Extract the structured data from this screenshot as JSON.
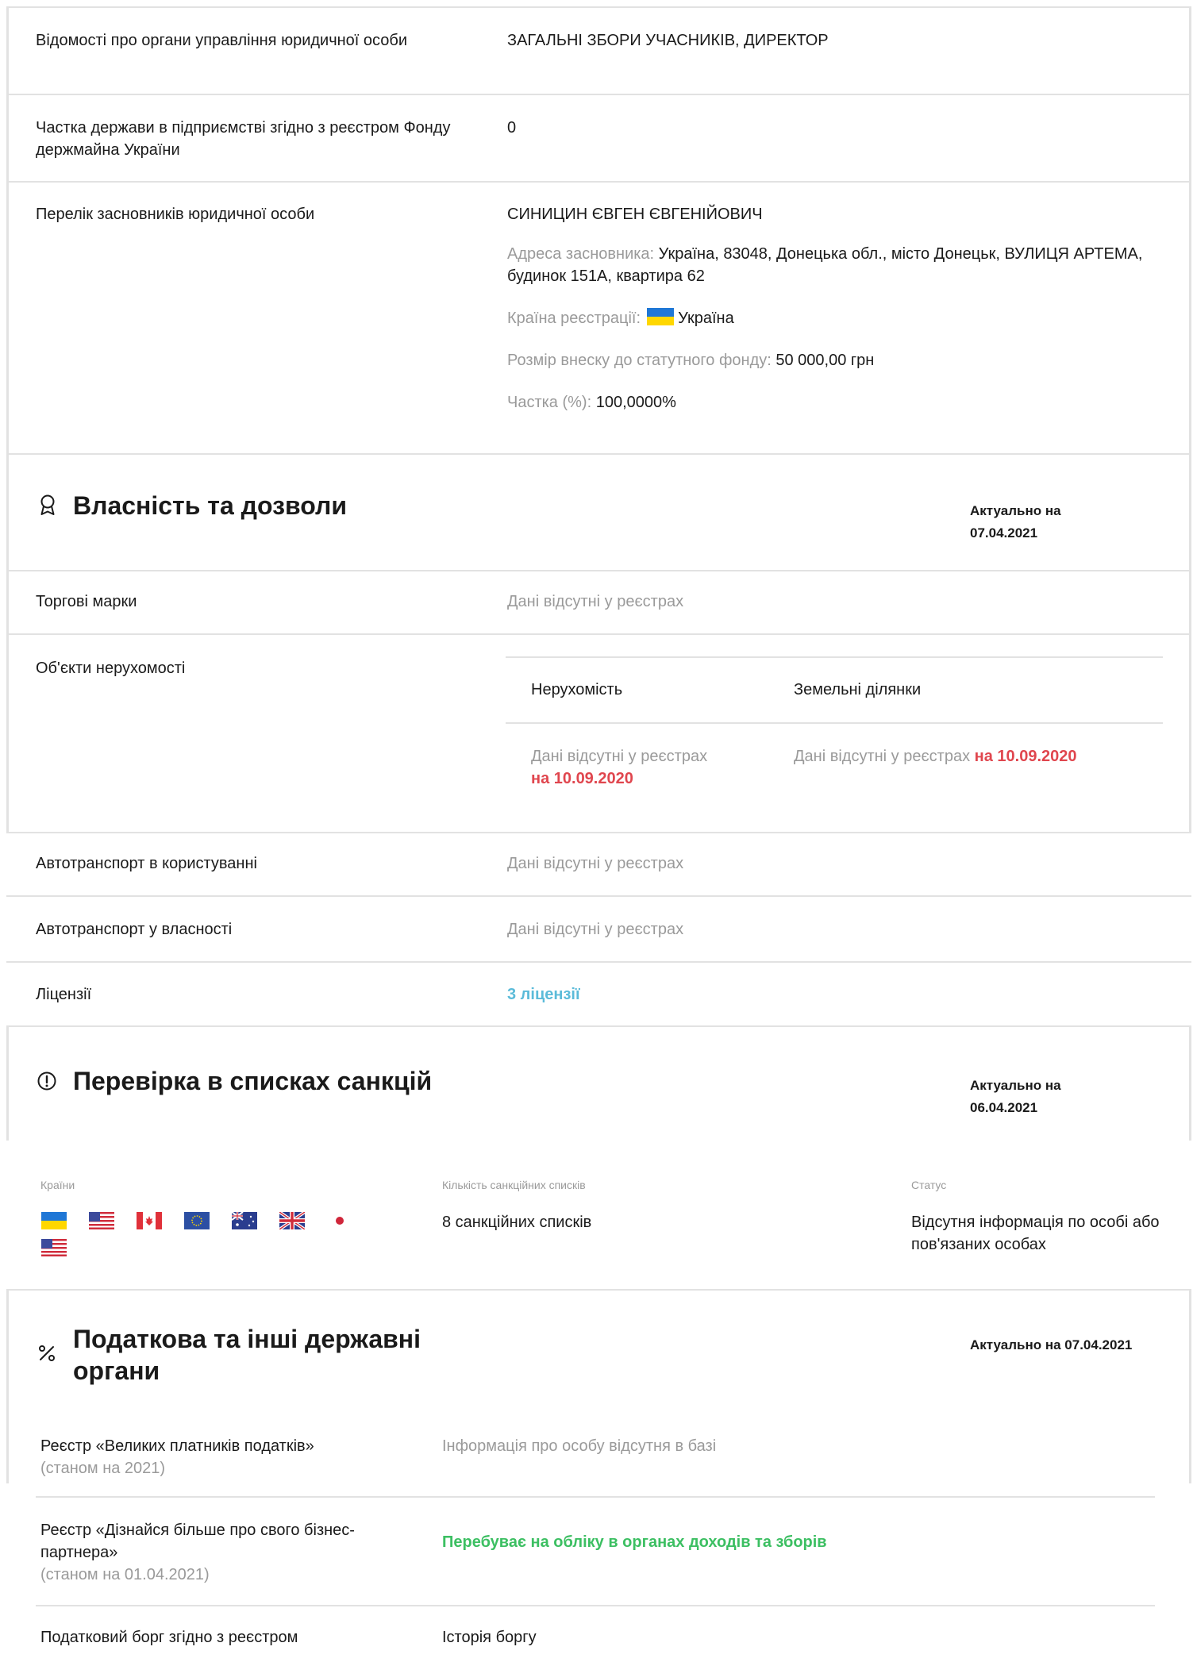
{
  "management": {
    "label": "Відомості про органи управління юридичної особи",
    "value": "ЗАГАЛЬНІ ЗБОРИ УЧАСНИКІВ, ДИРЕКТОР"
  },
  "state_share": {
    "label": "Частка держави в підприємстві згідно з реєстром Фонду держмайна України",
    "value": "0"
  },
  "founders": {
    "label": "Перелік засновників юридичної особи",
    "name": "СИНИЦИН ЄВГЕН ЄВГЕНІЙОВИЧ",
    "address_label": "Адреса засновника:",
    "address_value": "Україна, 83048, Донецька обл., місто Донецьк, ВУЛИЦЯ АРТЕМА, будинок 151А, квартира 62",
    "country_label": "Країна реєстрації:",
    "country_value": "Україна",
    "contribution_label": "Розмір внеску до статутного фонду:",
    "contribution_value": "50 000,00 грн",
    "share_label": "Частка (%):",
    "share_value": "100,0000%"
  },
  "property": {
    "title": "Власність та дозволи",
    "actual_line1": "Актуально на",
    "actual_line2": "07.04.2021",
    "trademarks_label": "Торгові марки",
    "trademarks_value": "Дані відсутні у реєстрах",
    "realty_label": "Об'єкти нерухомості",
    "realty_col1": "Нерухомість",
    "realty_col2": "Земельні ділянки",
    "realty_col1_value": "Дані відсутні у реєстрах",
    "realty_col1_date": "на 10.09.2020",
    "realty_col2_value": "Дані відсутні у реєстрах",
    "realty_col2_date": "на 10.09.2020",
    "vehicles_use_label": "Автотранспорт в користуванні",
    "vehicles_use_value": "Дані відсутні у реєстрах",
    "vehicles_own_label": "Автотранспорт у власності",
    "vehicles_own_value": "Дані відсутні у реєстрах",
    "licenses_label": "Ліцензії",
    "licenses_value": "3 ліцензії"
  },
  "sanctions": {
    "title": "Перевірка в списках санкцій",
    "actual_line1": "Актуально на",
    "actual_line2": "06.04.2021",
    "countries_header": "Країни",
    "count_header": "Кількість санкційних списків",
    "status_header": "Статус",
    "count_value": "8 санкційних списків",
    "status_value": "Відсутня інформація по особі або пов'язаних особах",
    "flags": [
      "ukraine-flag-icon",
      "usa-flag-icon",
      "canada-flag-icon",
      "eu-flag-icon",
      "australia-flag-icon",
      "uk-flag-icon",
      "japan-flag-icon",
      "usa-flag-icon"
    ]
  },
  "tax": {
    "title": "Податкова та інші державні органи",
    "actual": "Актуально на 07.04.2021",
    "large_payers_label": "Реєстр «Великих платників податків»",
    "large_payers_note": "(станом на 2021)",
    "large_payers_value": "Інформація про особу відсутня в базі",
    "partner_label": "Реєстр «Дізнайся більше про свого бізнес-партнера»",
    "partner_note": "(станом на 01.04.2021)",
    "partner_value": "Перебуває на обліку в органах доходів та зборів",
    "debt_label": "Податковий борг згідно з реєстром",
    "debt_value": "Історія боргу"
  },
  "colors": {
    "red": "#e0464e",
    "blue": "#5bbbd9",
    "green": "#3cbf62",
    "muted": "#9a9a9a",
    "border": "#e2e2e2"
  }
}
